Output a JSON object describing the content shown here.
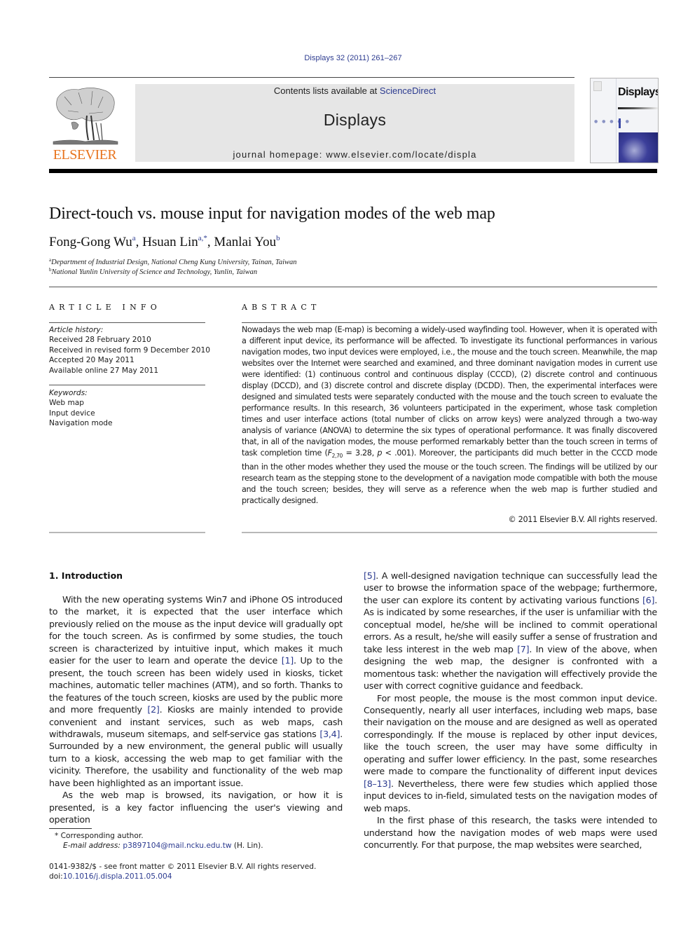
{
  "header": {
    "citation": "Displays 32 (2011) 261–267",
    "publisher_logo_text": "ELSEVIER",
    "contents_prefix": "Contents lists available at ",
    "contents_link": "ScienceDirect",
    "journal_name": "Displays",
    "homepage": "journal homepage: www.elsevier.com/locate/displa",
    "cover_title": "Displays",
    "colors": {
      "logo_orange": "#e8741e",
      "link_blue": "#2b3a8f",
      "band_gray": "#e6e6e6"
    }
  },
  "article": {
    "title": "Direct-touch vs. mouse input for navigation modes of the web map",
    "authors": [
      {
        "name": "Fong-Gong Wu",
        "sup": "a"
      },
      {
        "name": "Hsuan Lin",
        "sup": "a,*"
      },
      {
        "name": "Manlai You",
        "sup": "b"
      }
    ],
    "affiliations": [
      {
        "sup": "a",
        "text": "Department of Industrial Design, National Cheng Kung University, Tainan, Taiwan"
      },
      {
        "sup": "b",
        "text": "National Yunlin University of Science and Technology, Yunlin, Taiwan"
      }
    ]
  },
  "article_info": {
    "heading": "ARTICLE INFO",
    "history_label": "Article history:",
    "history": [
      "Received 28 February 2010",
      "Received in revised form 9 December 2010",
      "Accepted 20 May 2011",
      "Available online 27 May 2011"
    ],
    "keywords_label": "Keywords:",
    "keywords": [
      "Web map",
      "Input device",
      "Navigation mode"
    ]
  },
  "abstract": {
    "heading": "ABSTRACT",
    "text_1": "Nowadays the web map (E-map) is becoming a widely-used wayfinding tool. However, when it is operated with a different input device, its performance will be affected. To investigate its functional performances in various navigation modes, two input devices were employed, i.e., the mouse and the touch screen. Meanwhile, the map websites over the Internet were searched and examined, and three dominant navigation modes in current use were identified: (1) continuous control and continuous display (CCCD), (2) discrete control and continuous display (DCCD), and (3) discrete control and discrete display (DCDD). Then, the experimental interfaces were designed and simulated tests were separately conducted with the mouse and the touch screen to evaluate the performance results. In this research, 36 volunteers participated in the experiment, whose task completion times and user interface actions (total number of clicks on arrow keys) were analyzed through a two-way analysis of variance (ANOVA) to determine the six types of operational performance. It was finally discovered that, in all of the navigation modes, the mouse performed remarkably better than the touch screen in terms of task completion time (",
    "stat_F": "F",
    "stat_sub": "2,70",
    "stat_val": " = 3.28, ",
    "stat_p": "p",
    "text_2": " < .001). Moreover, the participants did much better in the CCCD mode than in the other modes whether they used the mouse or the touch screen. The findings will be utilized by our research team as the stepping stone to the development of a navigation mode compatible with both the mouse and the touch screen; besides, they will serve as a reference when the web map is further studied and practically designed.",
    "copyright": "© 2011 Elsevier B.V. All rights reserved."
  },
  "body": {
    "section_heading": "1. Introduction",
    "left_p1": [
      "With the new operating systems Win7 and iPhone OS introduced to the market, it is expected that the user interface which previously relied on the mouse as the input device will gradually opt for the touch screen. As is confirmed by some studies, the touch screen is characterized by intuitive input, which makes it much easier for the user to learn and operate the device ",
      "[1]",
      ". Up to the present, the touch screen has been widely used in kiosks, ticket machines, automatic teller machines (ATM), and so forth. Thanks to the features of the touch screen, kiosks are used by the public more and more frequently ",
      "[2]",
      ". Kiosks are mainly intended to provide convenient and instant services, such as web maps, cash withdrawals, museum sitemaps, and self-service gas stations ",
      "[3,4]",
      ". Surrounded by a new environment, the general public will usually turn to a kiosk, accessing the web map to get familiar with the vicinity. Therefore, the usability and functionality of the web map have been highlighted as an important issue."
    ],
    "left_p2": "As the web map is browsed, its navigation, or how it is presented, is a key factor influencing the user's viewing and operation",
    "right_p1": [
      "[5]",
      ". A well-designed navigation technique can successfully lead the user to browse the information space of the webpage; furthermore, the user can explore its content by activating various functions ",
      "[6]",
      ". As is indicated by some researches, if the user is unfamiliar with the conceptual model, he/she will be inclined to commit operational errors. As a result, he/she will easily suffer a sense of frustration and take less interest in the web map ",
      "[7]",
      ". In view of the above, when designing the web map, the designer is confronted with a momentous task: whether the navigation will effectively provide the user with correct cognitive guidance and feedback."
    ],
    "right_p2": [
      "For most people, the mouse is the most common input device. Consequently, nearly all user interfaces, including web maps, base their navigation on the mouse and are designed as well as operated correspondingly. If the mouse is replaced by other input devices, like the touch screen, the user may have some difficulty in operating and suffer lower efficiency. In the past, some researches were made to compare the functionality of different input devices ",
      "[8–13]",
      ". Nevertheless, there were few studies which applied those input devices to in-field, simulated tests on the navigation modes of web maps."
    ],
    "right_p3": "In the first phase of this research, the tasks were intended to understand how the navigation modes of web maps were used concurrently. For that purpose, the map websites were searched,"
  },
  "footnotes": {
    "corresponding": "* Corresponding author.",
    "email_label": "E-mail address: ",
    "email": "p3897104@mail.ncku.edu.tw",
    "email_suffix": " (H. Lin).",
    "issn_line": "0141-9382/$ - see front matter © 2011 Elsevier B.V. All rights reserved.",
    "doi_label": "doi:",
    "doi": "10.1016/j.displa.2011.05.004"
  }
}
